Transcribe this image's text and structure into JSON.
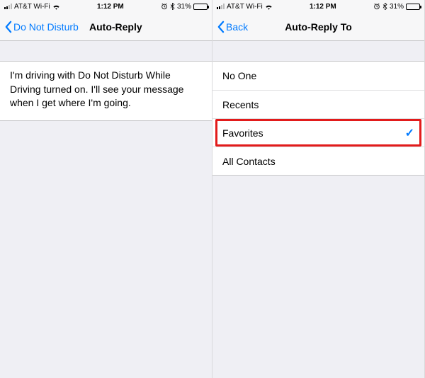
{
  "left": {
    "status": {
      "carrier": "AT&T Wi-Fi",
      "time": "1:12 PM",
      "battery_pct": "31%"
    },
    "nav": {
      "back_label": "Do Not Disturb",
      "title": "Auto-Reply"
    },
    "message": "I'm driving with Do Not Disturb While Driving turned on. I'll see your message when I get where I'm going."
  },
  "right": {
    "status": {
      "carrier": "AT&T Wi-Fi",
      "time": "1:12 PM",
      "battery_pct": "31%"
    },
    "nav": {
      "back_label": "Back",
      "title": "Auto-Reply To"
    },
    "options": {
      "no_one": "No One",
      "recents": "Recents",
      "favorites": "Favorites",
      "all_contacts": "All Contacts",
      "selected": "favorites",
      "check_glyph": "✓"
    }
  }
}
